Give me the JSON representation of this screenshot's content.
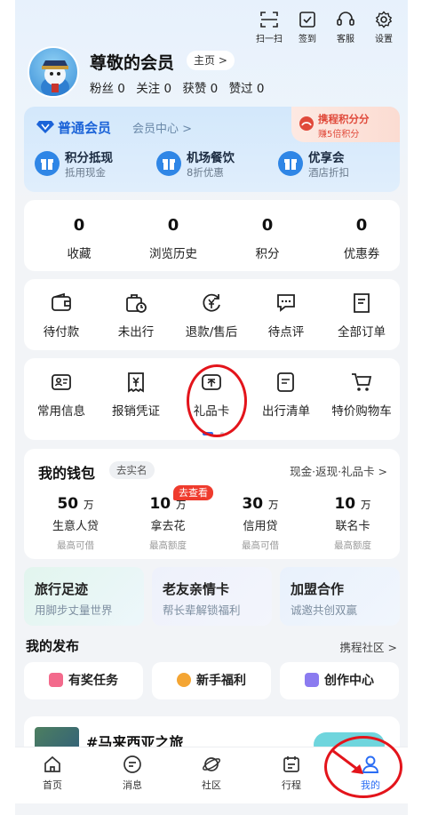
{
  "toolbar": {
    "scan": "扫一扫",
    "checkin": "签到",
    "service": "客服",
    "settings": "设置"
  },
  "profile": {
    "name": "尊敬的会员",
    "home_button": "主页 >",
    "stats": [
      {
        "label": "粉丝",
        "value": "0"
      },
      {
        "label": "关注",
        "value": "0"
      },
      {
        "label": "获赞",
        "value": "0"
      },
      {
        "label": "赞过",
        "value": "0"
      }
    ]
  },
  "membership": {
    "title": "普通会员",
    "center_link": "会员中心 >",
    "promo_title": "携程积分分",
    "promo_sub": "赚5倍积分",
    "benefits": [
      {
        "title": "积分抵现",
        "sub": "抵用现金"
      },
      {
        "title": "机场餐饮",
        "sub": "8折优惠"
      },
      {
        "title": "优享会",
        "sub": "酒店折扣"
      }
    ]
  },
  "counters": [
    {
      "value": "0",
      "label": "收藏"
    },
    {
      "value": "0",
      "label": "浏览历史"
    },
    {
      "value": "0",
      "label": "积分"
    },
    {
      "value": "0",
      "label": "优惠券"
    }
  ],
  "orders": [
    {
      "label": "待付款",
      "icon": "wallet-icon"
    },
    {
      "label": "未出行",
      "icon": "suitcase-clock-icon"
    },
    {
      "label": "退款/售后",
      "icon": "refund-icon"
    },
    {
      "label": "待点评",
      "icon": "comment-icon"
    },
    {
      "label": "全部订单",
      "icon": "orders-icon"
    }
  ],
  "tools": [
    {
      "label": "常用信息",
      "icon": "id-card-icon"
    },
    {
      "label": "报销凭证",
      "icon": "receipt-icon"
    },
    {
      "label": "礼品卡",
      "icon": "gift-card-icon"
    },
    {
      "label": "出行清单",
      "icon": "checklist-icon"
    },
    {
      "label": "特价购物车",
      "icon": "cart-icon"
    }
  ],
  "wallet": {
    "title": "我的钱包",
    "verify": "去实名",
    "link": "现金·返现·礼品卡 >",
    "hot_badge": "去查看",
    "items": [
      {
        "amount": "50",
        "unit": "万",
        "name": "生意人贷",
        "sub": "最高可借"
      },
      {
        "amount": "10",
        "unit": "万",
        "name": "拿去花",
        "sub": "最高额度"
      },
      {
        "amount": "30",
        "unit": "万",
        "name": "信用贷",
        "sub": "最高可借"
      },
      {
        "amount": "10",
        "unit": "万",
        "name": "联名卡",
        "sub": "最高额度"
      }
    ]
  },
  "features": [
    {
      "title": "旅行足迹",
      "sub": "用脚步丈量世界"
    },
    {
      "title": "老友亲情卡",
      "sub": "帮长辈解锁福利"
    },
    {
      "title": "加盟合作",
      "sub": "诚邀共创双赢"
    }
  ],
  "publish": {
    "title": "我的发布",
    "link": "携程社区 >",
    "buttons": [
      {
        "label": "有奖任务"
      },
      {
        "label": "新手福利"
      },
      {
        "label": "创作中心"
      }
    ],
    "post_title": "#马来西亚之旅"
  },
  "tabs": [
    {
      "label": "首页",
      "icon": "home-icon"
    },
    {
      "label": "消息",
      "icon": "message-icon"
    },
    {
      "label": "社区",
      "icon": "planet-icon"
    },
    {
      "label": "行程",
      "icon": "calendar-icon"
    },
    {
      "label": "我的",
      "icon": "person-icon",
      "active": true
    }
  ],
  "colors": {
    "brand": "#1b63d8",
    "active_tab": "#2a6df4",
    "annotation": "#e3141b",
    "hot_badge": "#ef3b2d"
  }
}
